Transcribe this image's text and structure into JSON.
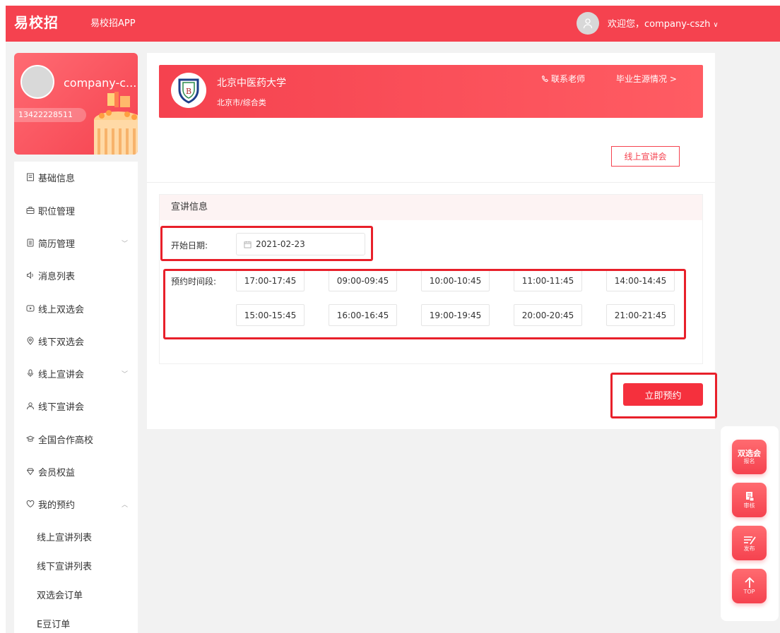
{
  "header": {
    "logo": "易校招",
    "app_link": "易校招APP",
    "welcome": "欢迎您，company-cszh"
  },
  "profile": {
    "name": "company-c...",
    "phone": "13422228511"
  },
  "sidebar": {
    "items": [
      {
        "label": "基础信息",
        "icon": "document-icon"
      },
      {
        "label": "职位管理",
        "icon": "briefcase-icon"
      },
      {
        "label": "简历管理",
        "icon": "resume-icon",
        "expand": "down"
      },
      {
        "label": "消息列表",
        "icon": "speaker-icon"
      },
      {
        "label": "线上双选会",
        "icon": "play-icon"
      },
      {
        "label": "线下双选会",
        "icon": "location-icon"
      },
      {
        "label": "线上宣讲会",
        "icon": "microphone-icon",
        "expand": "down"
      },
      {
        "label": "线下宣讲会",
        "icon": "people-icon"
      },
      {
        "label": "全国合作高校",
        "icon": "graduation-cap-icon"
      },
      {
        "label": "会员权益",
        "icon": "diamond-icon"
      },
      {
        "label": "我的预约",
        "icon": "heart-icon",
        "expand": "up"
      }
    ],
    "sub_items": [
      "线上宣讲列表",
      "线下宣讲列表",
      "双选会订单",
      "E豆订单"
    ]
  },
  "school": {
    "name": "北京中医药大学",
    "subtitle": "北京市/综合类",
    "contact": "联系老师",
    "source": "毕业生源情况 >"
  },
  "online_button": "线上宣讲会",
  "form": {
    "title": "宣讲信息",
    "date_label": "开始日期:",
    "date_value": "2021-02-23",
    "slot_label": "预约时间段:",
    "slots": [
      "17:00-17:45",
      "09:00-09:45",
      "10:00-10:45",
      "11:00-11:45",
      "14:00-14:45",
      "15:00-15:45",
      "16:00-16:45",
      "19:00-19:45",
      "20:00-20:45",
      "21:00-21:45"
    ]
  },
  "book_button": "立即预约",
  "float": {
    "fair_title": "双选会",
    "fair_sub": "报名",
    "review": "审核",
    "publish": "发布",
    "top": "TOP"
  },
  "colors": {
    "brand": "#f5424f",
    "highlight": "#e8202a"
  }
}
